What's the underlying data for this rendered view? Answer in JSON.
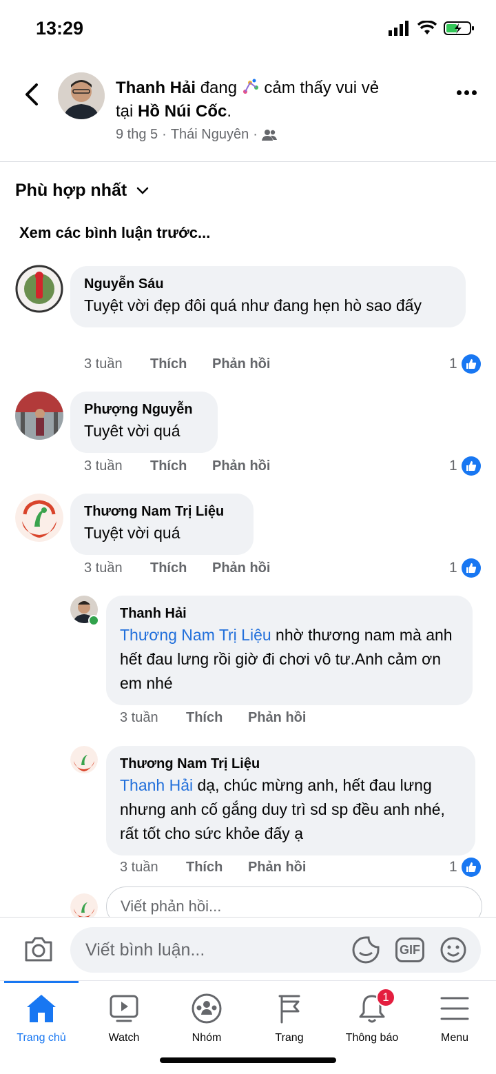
{
  "status": {
    "time": "13:29"
  },
  "post": {
    "author": "Thanh Hải",
    "verb": "đang",
    "feeling": "cảm thấy vui vẻ",
    "preposition": "tại",
    "place": "Hồ Núi Cốc",
    "date": "9 thg 5",
    "location": "Thái Nguyên"
  },
  "sort": {
    "label": "Phù hợp nhất"
  },
  "prev_comments": "Xem các bình luận trước...",
  "comments": [
    {
      "name": "Nguyễn Sáu",
      "text": "Tuyệt  vời  đẹp đôi quá  như đang hẹn hò sao đấy",
      "time": "3 tuần",
      "like": "Thích",
      "reply": "Phản hồi",
      "reactions": "1"
    },
    {
      "name": "Phượng Nguyễn",
      "text": "Tuyêt vời quá",
      "time": "3 tuần",
      "like": "Thích",
      "reply": "Phản hồi",
      "reactions": "1"
    },
    {
      "name": "Thương Nam Trị Liệu",
      "text": "Tuyệt vời quá",
      "time": "3 tuần",
      "like": "Thích",
      "reply": "Phản hồi",
      "reactions": "1"
    },
    {
      "name": "Thanh Hải",
      "mention": "Thương Nam Trị Liệu",
      "text": " nhờ thương nam mà anh hết đau lưng rồi giờ đi chơi vô tư.Anh cảm ơn em nhé",
      "time": "3 tuần",
      "like": "Thích",
      "reply": "Phản hồi"
    },
    {
      "name": "Thương Nam Trị Liệu",
      "mention": "Thanh Hải",
      "text": " dạ, chúc mừng anh, hết đau lưng nhưng anh cố gắng duy trì sd sp đều anh nhé, rất tốt cho sức khỏe đấy ạ",
      "time": "3 tuần",
      "like": "Thích",
      "reply": "Phản hồi",
      "reactions": "1"
    }
  ],
  "reply_placeholder": "Viết phản hồi...",
  "composer_placeholder": "Viết bình luận...",
  "composer_gif": "GIF",
  "tabs": [
    {
      "label": "Trang chủ",
      "icon": "home-icon"
    },
    {
      "label": "Watch",
      "icon": "watch-icon"
    },
    {
      "label": "Nhóm",
      "icon": "groups-icon"
    },
    {
      "label": "Trang",
      "icon": "pages-flag-icon"
    },
    {
      "label": "Thông báo",
      "icon": "bell-icon",
      "badge": "1"
    },
    {
      "label": "Menu",
      "icon": "menu-icon"
    }
  ],
  "colors": {
    "accent": "#1877f2",
    "bubble": "#f0f2f5",
    "muted": "#65676b",
    "badge": "#e41e3f"
  }
}
